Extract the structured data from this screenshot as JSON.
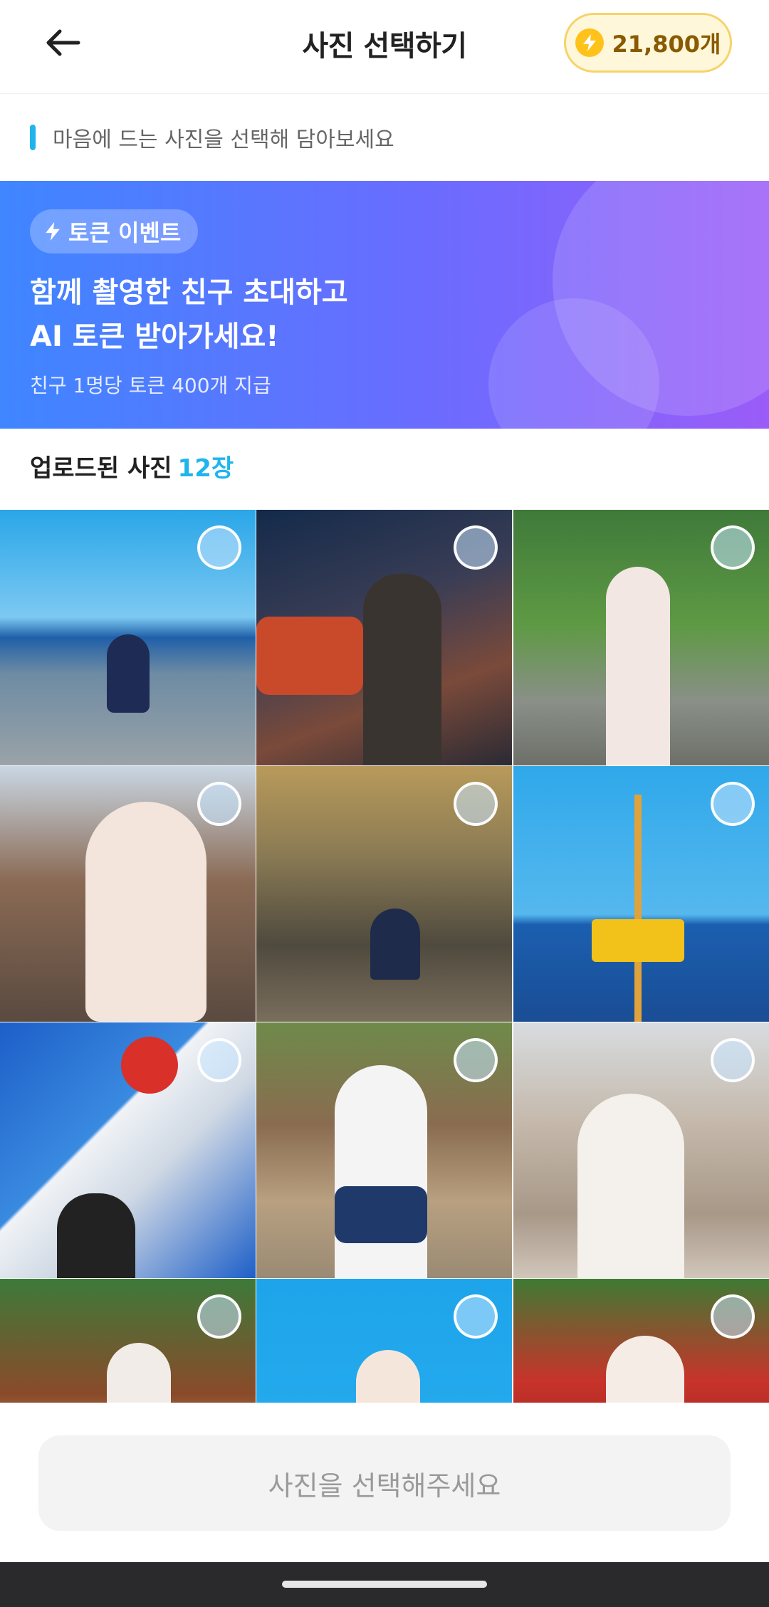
{
  "header": {
    "title": "사진 선택하기",
    "token_count": "21,800개"
  },
  "subtitle": "마음에 드는 사진을 선택해 담아보세요",
  "banner": {
    "badge": "토큰 이벤트",
    "headline_line1": "함께 촬영한 친구 초대하고",
    "headline_line2": "AI 토큰 받아가세요!",
    "sub": "친구 1명당 토큰 400개 지급"
  },
  "uploaded": {
    "label": "업로드된 사진",
    "count": "12장"
  },
  "photos": [
    {
      "name": "seaside-road"
    },
    {
      "name": "night-street-taxi"
    },
    {
      "name": "garden-yukata"
    },
    {
      "name": "pagoda-kimono"
    },
    {
      "name": "shop-front"
    },
    {
      "name": "sea-mirror"
    },
    {
      "name": "glico-sign"
    },
    {
      "name": "school-uniform-street"
    },
    {
      "name": "alley-smile"
    },
    {
      "name": "shrine-stalls"
    },
    {
      "name": "blue-sky-portrait"
    },
    {
      "name": "red-gate-portrait"
    }
  ],
  "cta": "사진을 선택해주세요",
  "colors": {
    "accent": "#1fb5ec",
    "banner_start": "#3f86ff",
    "banner_end": "#9b5cf8",
    "token_bg": "#fff7d9"
  }
}
